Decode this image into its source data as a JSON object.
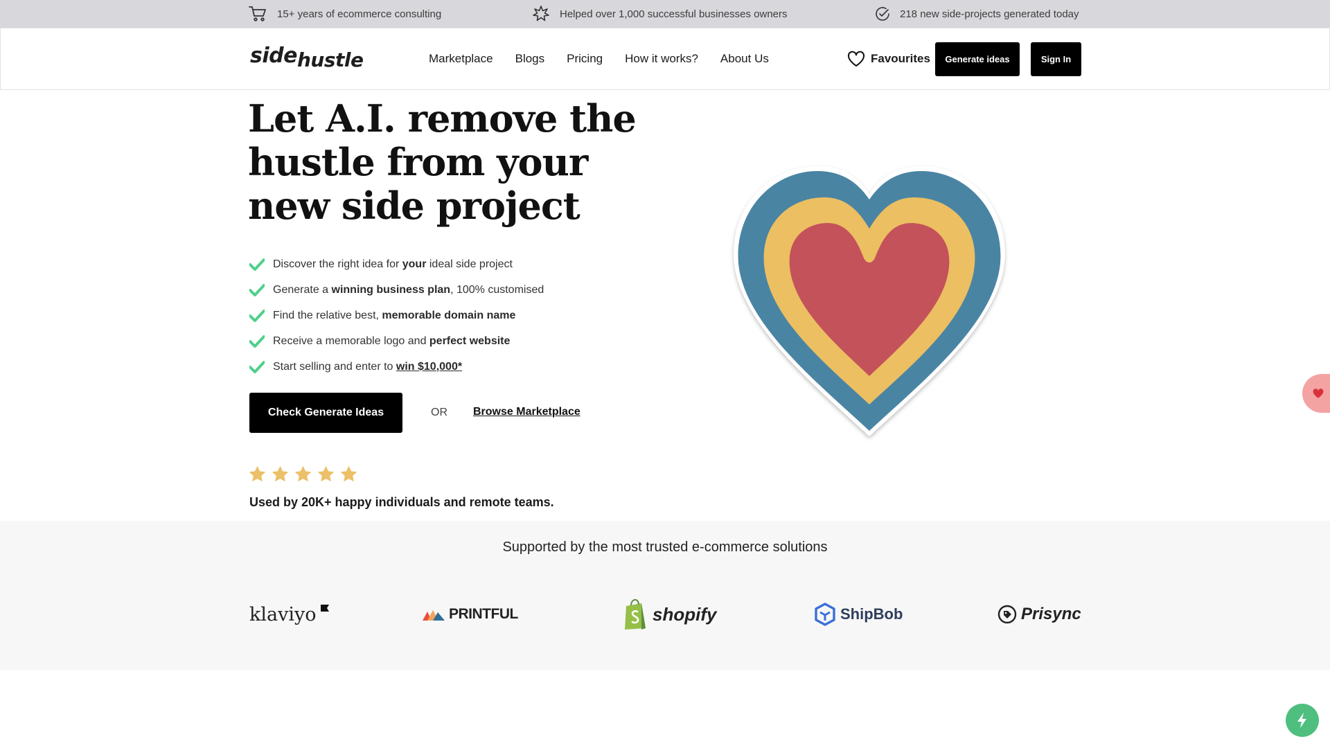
{
  "topbar": {
    "items": [
      {
        "icon": "cart-icon",
        "text": "15+ years of ecommerce consulting"
      },
      {
        "icon": "sparkle-icon",
        "text": "Helped over 1,000 successful businesses owners"
      },
      {
        "icon": "verified-icon",
        "text": "218 new side-projects generated today"
      }
    ]
  },
  "header": {
    "logo_part1": "side",
    "logo_part2": "hustle",
    "nav": [
      "Marketplace",
      "Blogs",
      "Pricing",
      "How it works?",
      "About Us"
    ],
    "favourites_label": "Favourites",
    "generate_label": "Generate ideas",
    "signin_label": "Sign In"
  },
  "hero": {
    "title": "Let A.I. remove the hustle from your new side project",
    "features": [
      {
        "pre": "Discover the right idea for ",
        "bold": "your",
        "post": " ideal side project"
      },
      {
        "pre": "Generate a ",
        "bold": "winning business plan",
        "post": ", 100% customised"
      },
      {
        "pre": "Find the relative best, ",
        "bold": "memorable domain name",
        "post": ""
      },
      {
        "pre": "Receive a memorable logo and ",
        "bold": "perfect website",
        "post": ""
      },
      {
        "pre": "Start selling and enter to ",
        "link": "win $10,000*",
        "post": ""
      }
    ],
    "cta_primary": "Check Generate Ideas",
    "or_text": "OR",
    "cta_secondary": "Browse Marketplace",
    "rating": 5,
    "rating_max": 5,
    "used_by": "Used by 20K+ happy individuals and remote teams."
  },
  "partners": {
    "title": "Supported by the most trusted e-commerce solutions",
    "logos": [
      "klaviyo",
      "PRINTFUL",
      "shopify",
      "ShipBob",
      "Prisync"
    ]
  },
  "colors": {
    "check_green": "#4fd08a",
    "star_gold": "#ecc068",
    "heart_blue": "#4a84a3",
    "heart_yellow": "#ebbf62",
    "heart_red": "#c4525a"
  }
}
